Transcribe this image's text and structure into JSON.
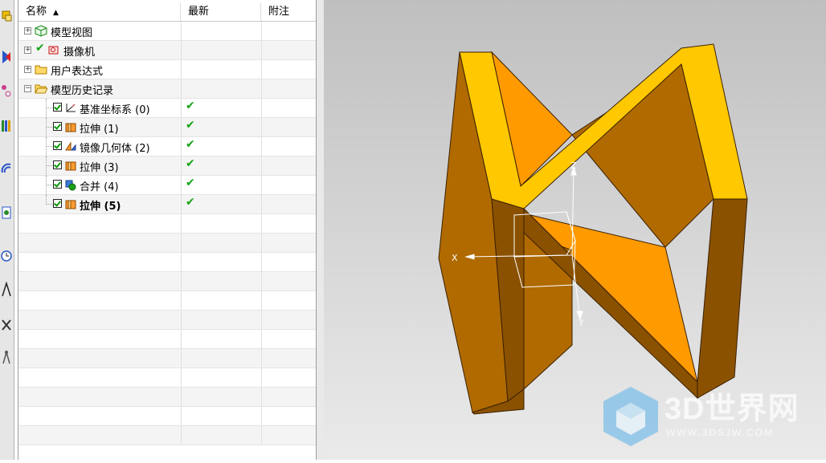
{
  "toolbar": {
    "icons": [
      "assembly-icon",
      "constraint-icon",
      "part-icon",
      "bookshelf-icon",
      "web-icon",
      "history-icon",
      "clock-icon",
      "measure-icon",
      "tools-icon",
      "roles-icon"
    ]
  },
  "navigator": {
    "columns": {
      "name": "名称",
      "latest": "最新",
      "comment": "附注"
    },
    "sort_indicator": "▲",
    "items": [
      {
        "label": "模型视图",
        "latest": ""
      },
      {
        "label": "摄像机",
        "latest": ""
      },
      {
        "label": "用户表达式",
        "latest": ""
      },
      {
        "label": "模型历史记录",
        "latest": ""
      },
      {
        "label": "基准坐标系 (0)",
        "latest": "✔"
      },
      {
        "label": "拉伸 (1)",
        "latest": "✔"
      },
      {
        "label": "镜像几何体 (2)",
        "latest": "✔"
      },
      {
        "label": "拉伸 (3)",
        "latest": "✔"
      },
      {
        "label": "合并 (4)",
        "latest": "✔"
      },
      {
        "label": "拉伸 (5)",
        "latest": "✔"
      }
    ]
  },
  "viewport": {
    "axis_labels": {
      "x": "X",
      "y": "Y",
      "z": "Z"
    },
    "colors": {
      "top_face": "#ffc800",
      "side_face": "#b06800",
      "dark_face": "#8a5100",
      "light_face": "#ff9a00",
      "background": "#d0d0d0"
    }
  },
  "watermark": {
    "text": "3D世界网",
    "url_text": "WWW.3DSJW.COM"
  }
}
